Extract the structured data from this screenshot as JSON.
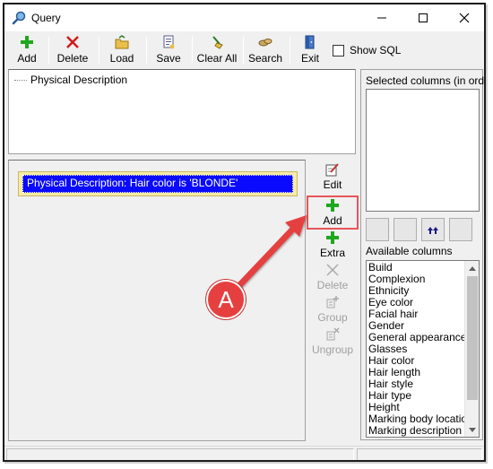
{
  "window": {
    "title": "Query",
    "controls": {
      "minimize": "minimize",
      "maximize": "maximize",
      "close": "close"
    }
  },
  "toolbar": {
    "buttons": [
      {
        "label": "Add",
        "icon": "add-icon"
      },
      {
        "label": "Delete",
        "icon": "delete-icon"
      },
      {
        "label": "Load",
        "icon": "load-icon"
      },
      {
        "label": "Save",
        "icon": "save-icon"
      },
      {
        "label": "Clear All",
        "icon": "clear-all-icon"
      },
      {
        "label": "Search",
        "icon": "search-icon"
      },
      {
        "label": "Exit",
        "icon": "exit-icon"
      }
    ],
    "show_sql": {
      "label": "Show SQL",
      "checked": false
    }
  },
  "tree": {
    "root_label": "Physical Description"
  },
  "criteria": {
    "items": [
      {
        "text": "Physical Description: Hair color is 'BLONDE'",
        "selected": true
      }
    ]
  },
  "side_commands": [
    {
      "label": "Edit",
      "icon": "edit-icon",
      "enabled": true
    },
    {
      "label": "Add",
      "icon": "add-icon",
      "enabled": true,
      "highlighted": true
    },
    {
      "label": "Extra",
      "icon": "add-extra-icon",
      "enabled": true
    },
    {
      "label": "Delete",
      "icon": "delete-icon",
      "enabled": false
    },
    {
      "label": "Group",
      "icon": "group-icon",
      "enabled": false
    },
    {
      "label": "Ungroup",
      "icon": "ungroup-icon",
      "enabled": false
    }
  ],
  "right_panel": {
    "selected_label": "Selected columns (in order)",
    "available_label": "Available columns",
    "move_buttons": [
      "blank-icon",
      "blank-icon",
      "move-top-icon",
      "blank-icon"
    ],
    "available_columns": [
      "Build",
      "Complexion",
      "Ethnicity",
      "Eye color",
      "Facial hair",
      "Gender",
      "General appearance",
      "Glasses",
      "Hair color",
      "Hair length",
      "Hair style",
      "Hair type",
      "Height",
      "Marking body location",
      "Marking description"
    ]
  },
  "annotation": {
    "callout_label": "A",
    "color": "#e5403f"
  },
  "colors": {
    "selection": "#0a0aff",
    "criteria_bg": "#f6eba8",
    "highlight": "#e8555a",
    "add_green": "#1fa81f",
    "delete_red": "#d11a1a"
  }
}
